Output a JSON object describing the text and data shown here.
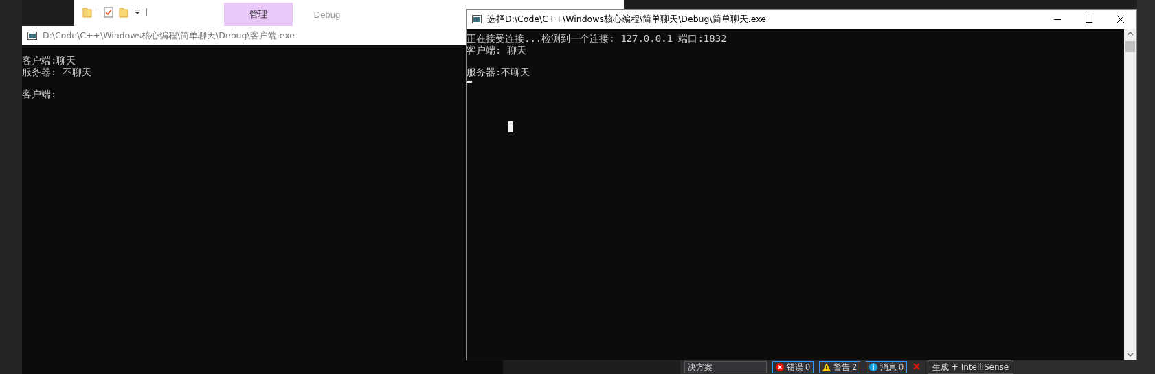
{
  "explorer_ribbon": {
    "tabs": [
      {
        "label": "管理",
        "selected": true
      },
      {
        "label": "Debug",
        "selected": false
      }
    ]
  },
  "client_console": {
    "title": "D:\\Code\\C++\\Windows核心编程\\简单聊天\\Debug\\客户端.exe",
    "active": false,
    "paragraphs": [
      [
        "客户端:聊天",
        "服务器: 不聊天"
      ],
      [
        "客户端:"
      ]
    ]
  },
  "server_console": {
    "title": "选择D:\\Code\\C++\\Windows核心编程\\简单聊天\\Debug\\简单聊天.exe",
    "active": true,
    "paragraphs": [
      [
        "正在接受连接...检测到一个连接: 127.0.0.1 端口:1832",
        "客户端: 聊天"
      ],
      [
        "服务器:不聊天"
      ]
    ]
  },
  "error_list": {
    "scope": "决方案",
    "buttons": [
      {
        "label": "错误 0",
        "kind": "error"
      },
      {
        "label": "警告 2",
        "kind": "warning"
      },
      {
        "label": "消息 0",
        "kind": "info"
      }
    ],
    "source": "生成 + IntelliSense"
  }
}
